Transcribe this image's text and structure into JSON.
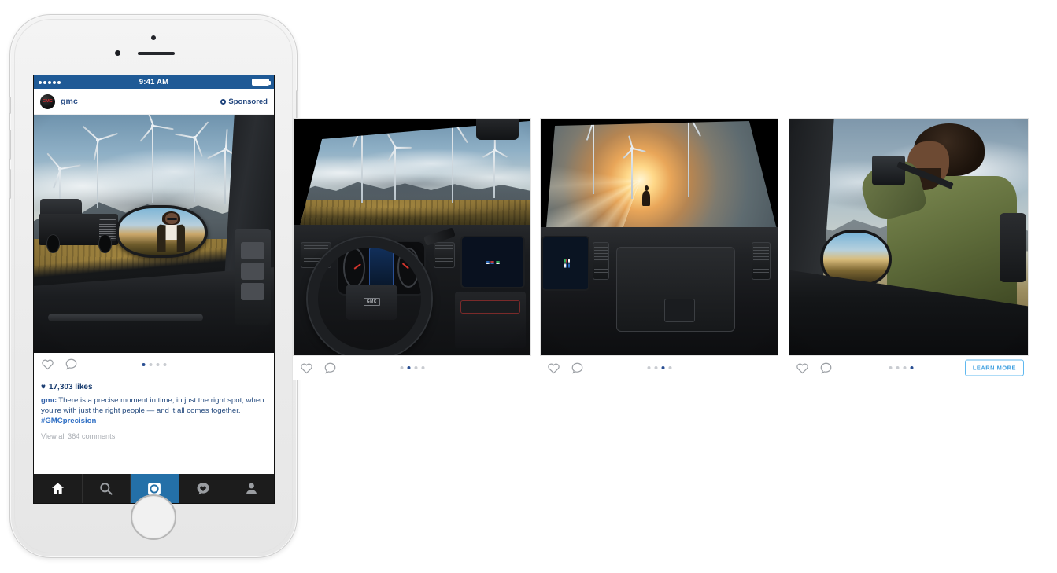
{
  "phone": {
    "status_bar": {
      "signal_dots": 5,
      "time": "9:41 AM",
      "battery_icon": "battery-full-icon"
    },
    "post": {
      "avatar_logo_text": "GMC",
      "username": "gmc",
      "sponsored_label": "Sponsored",
      "sponsored_icon": "info-circle-icon",
      "like_icon": "heart-outline-icon",
      "comment_icon": "comment-bubble-icon",
      "carousel_dots": 4,
      "carousel_active_index": 0,
      "likes_heart_glyph": "♥",
      "likes_text": "17,303 likes",
      "caption_username": "gmc",
      "caption_text": "There is a precise moment in time, in just the right spot, when you're with just the right people  — and it all comes together.",
      "caption_hashtag": "#GMCprecision",
      "comments_link": "View all 364 comments"
    },
    "tabbar": {
      "items": [
        {
          "name": "home-tab",
          "icon": "home-icon",
          "active": false
        },
        {
          "name": "search-tab",
          "icon": "search-icon",
          "active": false
        },
        {
          "name": "camera-tab",
          "icon": "camera-icon",
          "active": true
        },
        {
          "name": "activity-tab",
          "icon": "heart-bubble-icon",
          "active": false
        },
        {
          "name": "profile-tab",
          "icon": "person-icon",
          "active": false
        }
      ]
    }
  },
  "panels": [
    {
      "name": "panel-cockpit",
      "scene": "GMC Sierra driver cockpit with steering wheel, gauge cluster and infotainment screen, wind turbine farm seen through windshield",
      "like_icon": "heart-outline-icon",
      "comment_icon": "comment-bubble-icon",
      "carousel_dots": 4,
      "carousel_active_index": 1,
      "cta": null
    },
    {
      "name": "panel-passenger-dash",
      "scene": "GMC Sierra passenger dashboard and glovebox with sunset over wind turbine field and a lone figure walking",
      "like_icon": "heart-outline-icon",
      "comment_icon": "comment-bubble-icon",
      "carousel_dots": 4,
      "carousel_active_index": 2,
      "cta": null
    },
    {
      "name": "panel-photographer",
      "scene": "Man in green jacket holding a camera leaning on the truck door, side mirror reflecting the desert landscape",
      "like_icon": "heart-outline-icon",
      "comment_icon": "comment-bubble-icon",
      "carousel_dots": 4,
      "carousel_active_index": 3,
      "cta": "LEARN MORE"
    }
  ],
  "colors": {
    "status_bar_blue": "#1f5a96",
    "instagram_text_blue": "#274c7f",
    "active_dot_blue": "#2a4f93",
    "cta_border_blue": "#5fb8ef",
    "cta_text_blue": "#3d9fe0",
    "tab_active_blue": "#2470a8",
    "tabbar_dark": "#1c1c1c",
    "gmc_red": "#d0282f"
  }
}
